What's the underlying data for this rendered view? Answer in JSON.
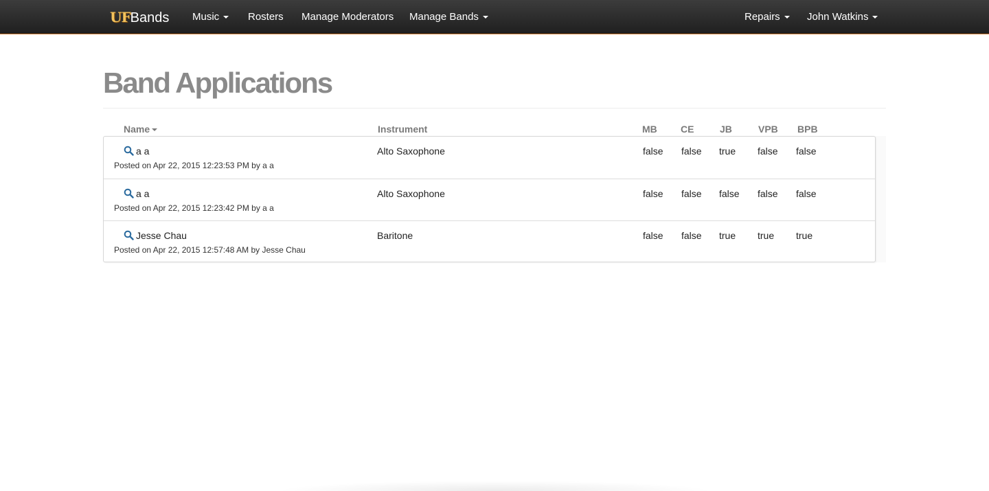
{
  "navbar": {
    "brand_uf": "UF",
    "brand_bands": "Bands",
    "items": [
      {
        "label": "Music",
        "dropdown": true
      },
      {
        "label": "Rosters",
        "dropdown": false
      },
      {
        "label": "Manage Moderators",
        "dropdown": false
      },
      {
        "label": "Manage Bands",
        "dropdown": true
      }
    ],
    "right_items": [
      {
        "label": "Repairs",
        "dropdown": true
      },
      {
        "label": "John Watkins",
        "dropdown": true
      }
    ]
  },
  "page": {
    "title": "Band Applications"
  },
  "table": {
    "headers": {
      "name": "Name",
      "instrument": "Instrument",
      "mb": "MB",
      "ce": "CE",
      "jb": "JB",
      "vpb": "VPB",
      "bpb": "BPB"
    },
    "sort": {
      "column": "name",
      "icon": "caret-down-icon"
    },
    "rows": [
      {
        "name": "a a",
        "posted": "Posted on Apr 22, 2015 12:23:53 PM by a a",
        "instrument": "Alto Saxophone",
        "mb": "false",
        "ce": "false",
        "jb": "true",
        "vpb": "false",
        "bpb": "false"
      },
      {
        "name": "a a",
        "posted": "Posted on Apr 22, 2015 12:23:42 PM by a a",
        "instrument": "Alto Saxophone",
        "mb": "false",
        "ce": "false",
        "jb": "false",
        "vpb": "false",
        "bpb": "false"
      },
      {
        "name": "Jesse Chau",
        "posted": "Posted on Apr 22, 2015 12:57:48 AM by Jesse Chau",
        "instrument": "Baritone",
        "mb": "false",
        "ce": "false",
        "jb": "true",
        "vpb": "true",
        "bpb": "true"
      }
    ]
  },
  "colors": {
    "navbar_bg": "#2b2b2b",
    "navbar_accent": "#c8752a",
    "brand_gold": "#f3c25c",
    "link_blue": "#2a6a9e",
    "title_gray": "#8a8a8a"
  }
}
